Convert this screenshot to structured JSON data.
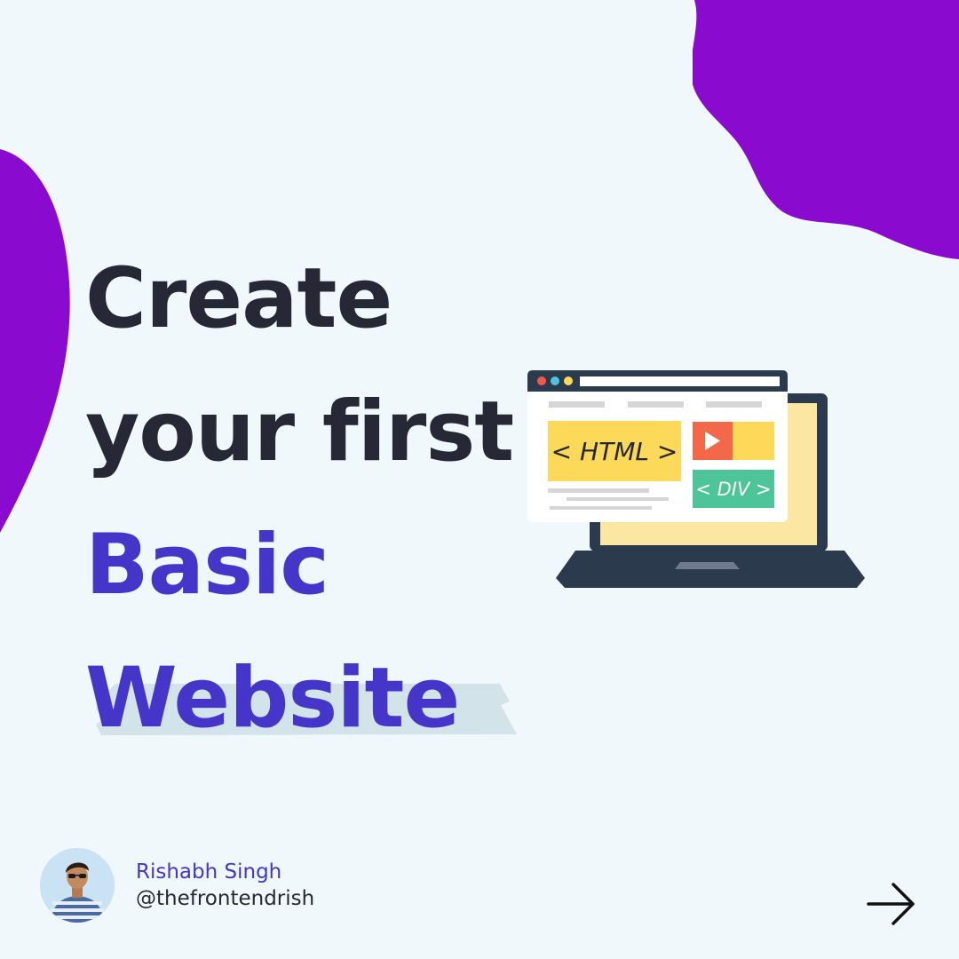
{
  "headline": {
    "line1": "Create",
    "line2": "your first",
    "line3": "Basic",
    "line4": "Website"
  },
  "illustration": {
    "html_tag_label": "< HTML >",
    "div_tag_label": "< DIV >"
  },
  "author": {
    "name": "Rishabh Singh",
    "handle": "@thefrontendrish"
  },
  "colors": {
    "background": "#f1f8fb",
    "blob": "#8b0ad0",
    "headline_dark": "#262835",
    "headline_accent": "#4535c9",
    "highlight": "#d3e3ea",
    "laptop_body": "#2c3a4e",
    "screen_yellow": "#fbe7a2",
    "html_box": "#fcd958",
    "play_button": "#f26849",
    "div_box": "#4ec49a"
  },
  "icons": {
    "next": "arrow-right-icon",
    "window_controls": [
      "red-dot",
      "blue-dot",
      "yellow-dot"
    ]
  }
}
